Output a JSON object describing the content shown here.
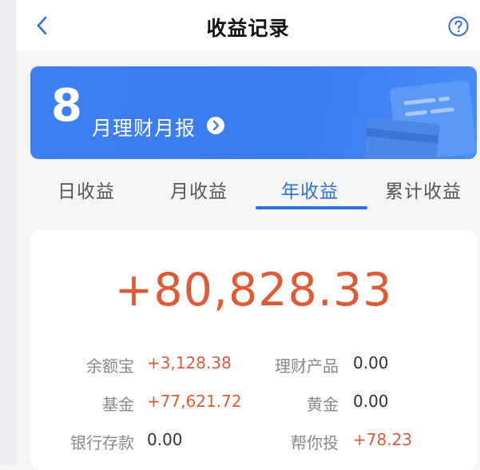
{
  "header": {
    "title": "收益记录",
    "back_icon": "chevron-left-icon",
    "help_icon": "question-circle-icon"
  },
  "banner": {
    "month_number": "8",
    "text": "月理财月报",
    "arrow_icon": "chevron-right-circle-icon"
  },
  "tabs": [
    {
      "label": "日收益",
      "active": false
    },
    {
      "label": "月收益",
      "active": false
    },
    {
      "label": "年收益",
      "active": true
    },
    {
      "label": "累计收益",
      "active": false
    }
  ],
  "summary": {
    "total": "+80,828.33",
    "rows": [
      {
        "label": "余额宝",
        "value": "+3,128.38"
      },
      {
        "label": "理财产品",
        "value": "0.00"
      },
      {
        "label": "基金",
        "value": "+77,621.72"
      },
      {
        "label": "黄金",
        "value": "0.00"
      },
      {
        "label": "银行存款",
        "value": "0.00"
      },
      {
        "label": "帮你投",
        "value": "+78.23"
      }
    ]
  },
  "colors": {
    "accent": "#2f6fd8",
    "banner": "#3d80f2",
    "positive": "#e05a35"
  }
}
